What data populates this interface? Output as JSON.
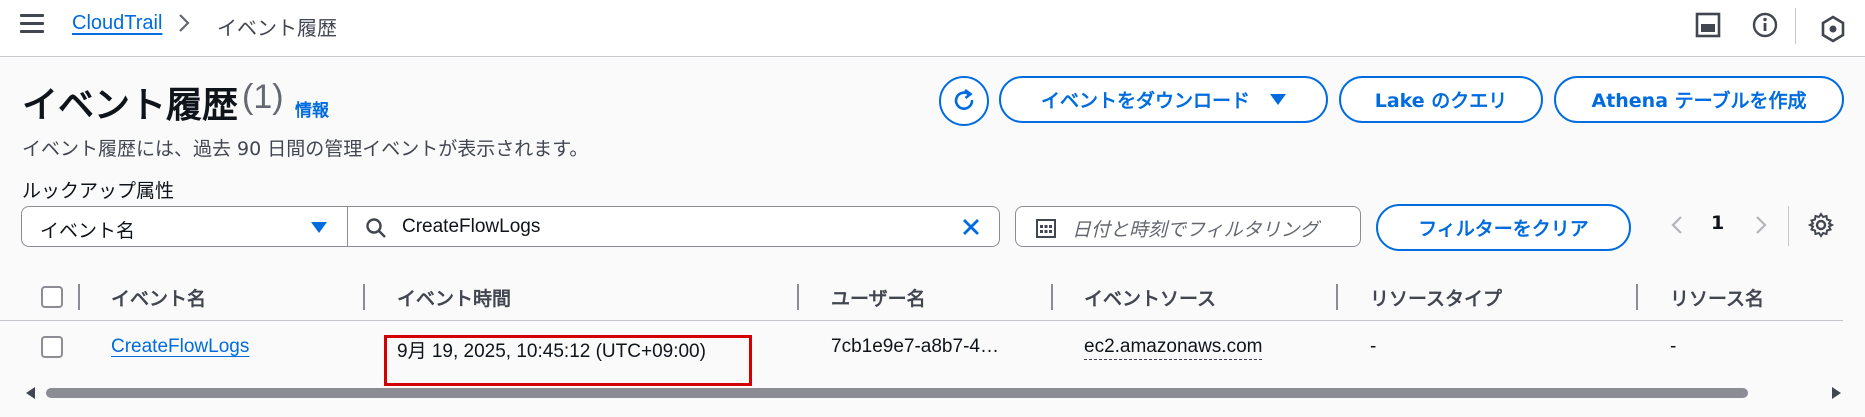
{
  "breadcrumb": {
    "root": "CloudTrail",
    "current": "イベント履歴"
  },
  "header": {
    "title": "イベント履歴",
    "count": "(1)",
    "info": "情報",
    "description": "イベント履歴には、過去 90 日間の管理イベントが表示されます。"
  },
  "actions": {
    "download": "イベントをダウンロード",
    "lake_query": "Lake のクエリ",
    "athena": "Athena テーブルを作成"
  },
  "lookup": {
    "label": "ルックアップ属性",
    "attribute": "イベント名",
    "search_value": "CreateFlowLogs",
    "date_placeholder": "日付と時刻でフィルタリング",
    "clear_filter": "フィルターをクリア"
  },
  "pagination": {
    "current_page": "1"
  },
  "table": {
    "columns": [
      "イベント名",
      "イベント時間",
      "ユーザー名",
      "イベントソース",
      "リソースタイプ",
      "リソース名"
    ],
    "rows": [
      {
        "event_name": "CreateFlowLogs",
        "event_time": "9月 19, 2025, 10:45:12 (UTC+09:00)",
        "user_name": "7cb1e9e7-a8b7-4…",
        "event_source": "ec2.amazonaws.com",
        "resource_type": "-",
        "resource_name": "-"
      }
    ]
  },
  "colors": {
    "accent": "#006ce0",
    "text": "#0f141a",
    "secondary_text": "#424650",
    "highlight": "#d40000"
  },
  "icons": [
    "menu-icon",
    "chevron-right-icon",
    "panel-icon",
    "info-icon",
    "notifications-icon",
    "refresh-icon",
    "caret-down-icon",
    "search-icon",
    "close-icon",
    "calendar-icon",
    "chevron-left-icon",
    "settings-icon"
  ]
}
